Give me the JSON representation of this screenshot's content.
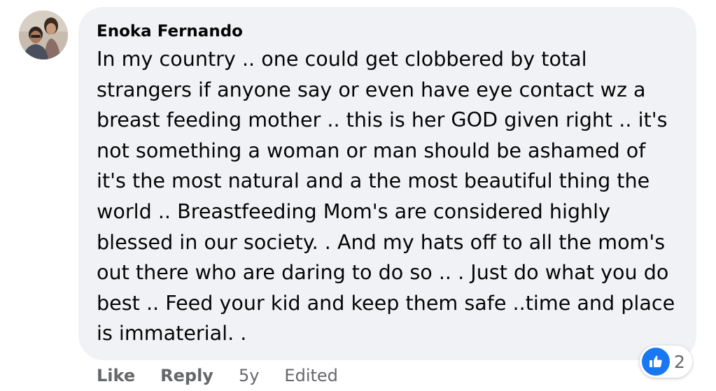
{
  "comment": {
    "author": "Enoka Fernando",
    "avatar_icon": "user-avatar-photo",
    "body_lines": [
      "In my country .. one could get clobbered by total",
      "strangers if anyone say or even have eye contact wz a",
      "breast feeding mother .. this is her GOD given right .. it's",
      "not something a woman or man should be ashamed of",
      "it's the most natural and a the most beautiful thing the",
      "world .. Breastfeeding Mom's are considered highly",
      "blessed in our society. . And my hats off to all the mom's",
      "out there who are daring to do so .. . Just do what you do",
      "best .. Feed your kid and keep them safe ..time and place",
      "is immaterial. ."
    ],
    "reactions": {
      "icon": "thumbs-up-icon",
      "count": "2"
    },
    "actions": {
      "like_label": "Like",
      "reply_label": "Reply",
      "timestamp": "5y",
      "edited_label": "Edited"
    }
  },
  "colors": {
    "bubble_bg": "#f0f2f5",
    "text": "#050505",
    "secondary_text": "#65676b",
    "like_blue": "#1877f2"
  }
}
